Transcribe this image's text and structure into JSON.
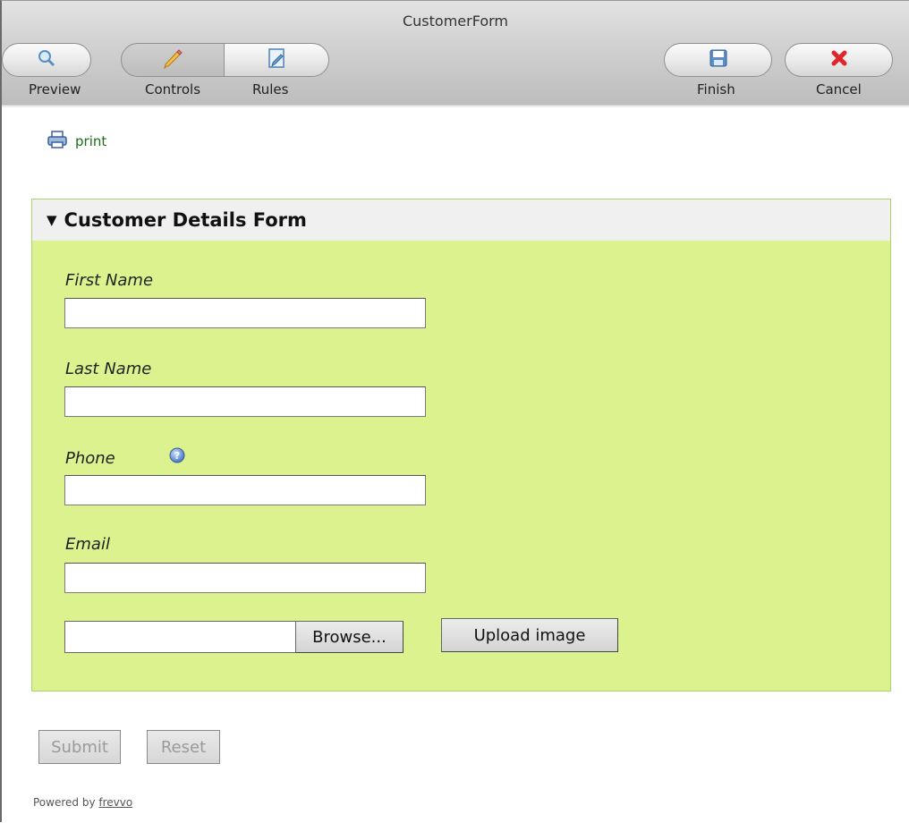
{
  "window": {
    "title": "CustomerForm"
  },
  "toolbar": {
    "preview_label": "Preview",
    "controls_label": "Controls",
    "rules_label": "Rules",
    "finish_label": "Finish",
    "cancel_label": "Cancel"
  },
  "print": {
    "label": "print"
  },
  "form": {
    "section_title": "Customer Details Form",
    "fields": [
      {
        "label": "First Name",
        "value": ""
      },
      {
        "label": "Last Name",
        "value": ""
      },
      {
        "label": "Phone",
        "value": ""
      },
      {
        "label": "Email",
        "value": ""
      }
    ],
    "file_value": "",
    "browse_label": "Browse...",
    "upload_label": "Upload image"
  },
  "actions": {
    "submit_label": "Submit",
    "reset_label": "Reset"
  },
  "footer": {
    "prefix": "Powered by ",
    "link": "frevvo"
  },
  "colors": {
    "form_bg": "#dcf28e",
    "form_border": "#a9d36e",
    "cancel_red": "#e0262b",
    "link_green": "#1a6e1a"
  },
  "icons": [
    "magnifier-icon",
    "pencil-icon",
    "rules-icon",
    "save-icon",
    "close-icon",
    "printer-icon",
    "help-icon",
    "triangle-down-icon"
  ]
}
